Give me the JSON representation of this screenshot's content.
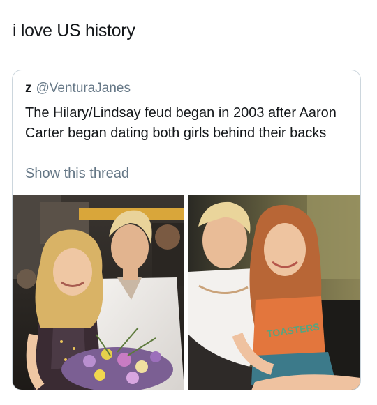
{
  "tweet": {
    "text": "i love US history"
  },
  "quoted_tweet": {
    "display_name": "z",
    "handle": "@VenturaJanes",
    "body": "The Hilary/Lindsay feud began in 2003 after Aaron Carter began dating both girls behind their backs",
    "show_thread_label": "Show this thread"
  },
  "media": {
    "photo_left_icon": "photo-hilary-aaron-icon",
    "photo_right_icon": "photo-aaron-lindsay-icon"
  }
}
